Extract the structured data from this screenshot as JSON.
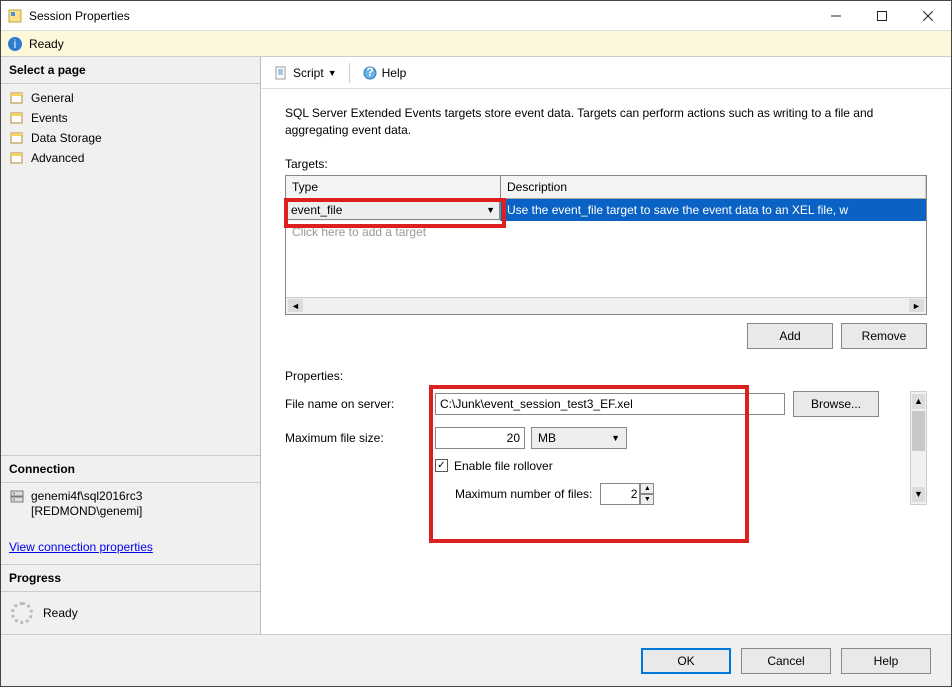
{
  "window": {
    "title": "Session Properties"
  },
  "readybar": {
    "text": "Ready"
  },
  "sidebar": {
    "select_page_header": "Select a page",
    "pages": [
      {
        "label": "General"
      },
      {
        "label": "Events"
      },
      {
        "label": "Data Storage"
      },
      {
        "label": "Advanced"
      }
    ],
    "connection_header": "Connection",
    "server": "genemi4f\\sql2016rc3",
    "user": "[REDMOND\\genemi]",
    "view_conn_link": "View connection properties",
    "progress_header": "Progress",
    "progress_text": "Ready"
  },
  "toolbar": {
    "script": "Script",
    "help": "Help"
  },
  "content": {
    "intro": "SQL Server Extended Events targets store event data. Targets can perform actions such as writing to a file and aggregating event data.",
    "targets_label": "Targets:",
    "table": {
      "type_header": "Type",
      "desc_header": "Description",
      "type_value": "event_file",
      "desc_value": "Use the event_file target to save the event data to an XEL file, w",
      "placeholder": "Click here to add a target"
    },
    "add": "Add",
    "remove": "Remove",
    "properties_label": "Properties:",
    "form": {
      "file_label": "File name on server:",
      "file_value": "C:\\Junk\\event_session_test3_EF.xel",
      "browse": "Browse...",
      "maxsize_label": "Maximum file size:",
      "maxsize_value": "20",
      "maxsize_unit": "MB",
      "rollover_label": "Enable file rollover",
      "maxfiles_label": "Maximum number of files:",
      "maxfiles_value": "2"
    }
  },
  "bottom": {
    "ok": "OK",
    "cancel": "Cancel",
    "help": "Help"
  }
}
